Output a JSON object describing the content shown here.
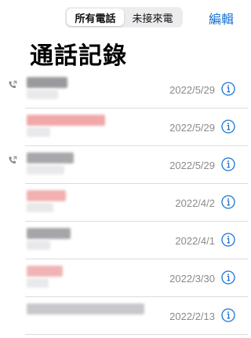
{
  "tabs": [
    {
      "label": "所有電話",
      "active": true
    },
    {
      "label": "未接來電",
      "active": false
    }
  ],
  "edit_label": "編輯",
  "title": "通話記錄",
  "accent": "#1a73d1",
  "calls": [
    {
      "date": "2022/5/29",
      "outgoing": true,
      "name_color": "#9a9a9e",
      "name_width": 52,
      "sub_width": 40
    },
    {
      "date": "2022/5/29",
      "outgoing": false,
      "name_color": "#f0a8a8",
      "name_width": 100,
      "sub_width": 30
    },
    {
      "date": "2022/5/29",
      "outgoing": true,
      "name_color": "#a8a8ac",
      "name_width": 60,
      "sub_width": 48
    },
    {
      "date": "2022/4/2",
      "outgoing": false,
      "name_color": "#f2b0b0",
      "name_width": 50,
      "sub_width": 34
    },
    {
      "date": "2022/4/1",
      "outgoing": false,
      "name_color": "#a6a6aa",
      "name_width": 56,
      "sub_width": 30
    },
    {
      "date": "2022/3/30",
      "outgoing": false,
      "name_color": "#f1b4b4",
      "name_width": 46,
      "sub_width": 28
    },
    {
      "date": "2022/2/13",
      "outgoing": false,
      "name_color": "#c8c8cc",
      "name_width": 150,
      "sub_width": 0
    }
  ]
}
